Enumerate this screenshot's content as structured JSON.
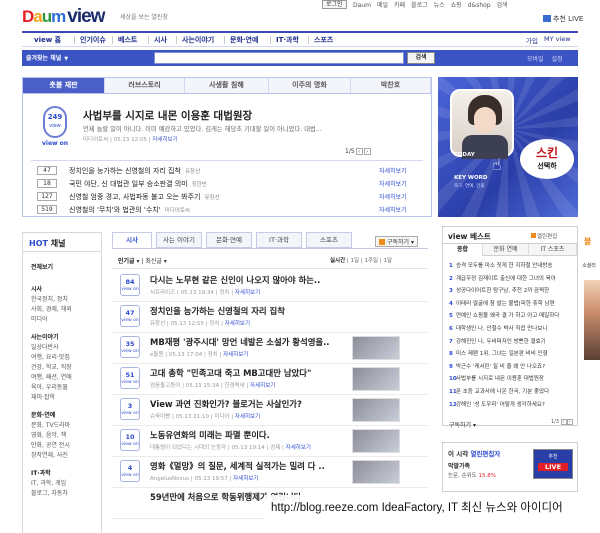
{
  "header": {
    "logo_brand": "Daum",
    "logo_product": "view",
    "tagline": "세상을 보는 열린창",
    "login_label": "로그인",
    "top_links": [
      "Daum",
      "메일",
      "카페",
      "블로그",
      "뉴스",
      "쇼핑",
      "d&shop",
      "검색"
    ],
    "recommend_label": "추천 LIVE"
  },
  "nav": {
    "items": [
      "view 홈",
      "인기이슈",
      "베스트",
      "시사",
      "사는이야기",
      "문화·연예",
      "IT·과학",
      "스포츠"
    ],
    "right_items": [
      "가입",
      "MY view"
    ]
  },
  "search": {
    "channel_label": "즐겨찾는 채널",
    "button_label": "검색",
    "right_links": [
      "모바일",
      "설정"
    ]
  },
  "featured": {
    "tabs": [
      "촛불 재판",
      "러브스토리",
      "사생활 침해",
      "이주의 명화",
      "박찬호"
    ],
    "badge_count": "249",
    "badge_unit": "view",
    "badge_label": "view on",
    "headline": "사법부를 시지로 내몬 이용훈 대법원장",
    "desc": "언제 놀랄 일이 아니다. 이미 예감하고 있었다. 김게는 해당초 기대할 일이 아니었다. 대법...",
    "meta_source": "미디어토씨",
    "meta_time": "05.13 12:05",
    "meta_more": "자세히보기",
    "pager": "1/5",
    "list": [
      {
        "count": "47",
        "title": "정치인을 능가하는 신영철의 자리 집착",
        "src": "유창선",
        "more": "자세히보기"
      },
      {
        "count": "18",
        "title": "국민 야단, 신 대법관 일부 승소판결 의미",
        "src": "정한빈",
        "more": "자세히보기"
      },
      {
        "count": "127",
        "title": "신영철 엄중 경고, 사법파동 불고 오는 봐주기",
        "src": "유창선",
        "more": "자세히보기"
      },
      {
        "count": "519",
        "title": "신영철의 '무치'와 법관의 '수치'",
        "src": "미디어토씨",
        "more": "자세히보기"
      }
    ]
  },
  "banner": {
    "today_label": "TODAY",
    "keyword_label": "KEY WORD",
    "sub_text": "죽구, 연예, 인물",
    "bubble_main": "스킨",
    "bubble_sub": "선택하"
  },
  "hot_channel": {
    "title_prefix": "HOT",
    "title_suffix": "채널",
    "all_label": "전체보기",
    "groups": [
      {
        "head": "시사",
        "lines": [
          "한국정치, 정치",
          "사회, 경제, 해외",
          "미디어"
        ]
      },
      {
        "head": "사는이야기",
        "lines": [
          "일상다반사",
          "여행, 요리·맛집",
          "건강, 학교, 직장",
          "여행, 패션, 연애",
          "육아, 우리동물",
          "재미·잡학"
        ]
      },
      {
        "head": "문화·연예",
        "lines": [
          "문화, TV드라마",
          "영화, 음악, 책",
          "만화, 공연 전시",
          "창작연재, 사진"
        ]
      },
      {
        "head": "IT·과학",
        "lines": [
          "IT, 과학, 게임",
          "블로그, 자동차"
        ]
      }
    ]
  },
  "center": {
    "tabs": [
      "시사",
      "사는 이야기",
      "문화·연예",
      "IT·과학",
      "스포츠"
    ],
    "subscribe_label": "구독하기",
    "sort_popular": "인기글",
    "sort_recent": "최신글",
    "live_label": "실시간",
    "live_periods": [
      "1일",
      "1주일",
      "1달"
    ],
    "articles": [
      {
        "count": "84",
        "unit": "view on",
        "title": "다시는 노무현 같은 신인이 나오지 않아야 하는..",
        "src": "서프라이즈",
        "time": "05.13 19:34",
        "cat": "정치",
        "more": "자세히보기",
        "thumb": false
      },
      {
        "count": "47",
        "unit": "view on",
        "title": "정치인을 능가하는 신영철의 자리 집착",
        "src": "유창선",
        "time": "05.13 12:55",
        "cat": "정치",
        "more": "자세히보기",
        "thumb": false
      },
      {
        "count": "35",
        "unit": "view on",
        "title": "MB재평 '광주시대' 망언 네발은 소설가 황석영을..",
        "src": "e돌쫑",
        "time": "05.13 17:04",
        "cat": "정치",
        "more": "자세히보기",
        "thumb": true
      },
      {
        "count": "51",
        "unit": "view on",
        "title": "고대 총학 \"민족고대 죽고 MB고대만 남았다\"",
        "src": "엄음돌고등어",
        "time": "05.13 15:34",
        "cat": "한겸퀵네",
        "more": "자세히보기",
        "thumb": true
      },
      {
        "count": "3",
        "unit": "view on",
        "title": "View 과연 진화인가? 블로거는 사살인가?",
        "src": "슈욱미빵",
        "time": "05.13 21:10",
        "cat": "미디어",
        "more": "자세히보기",
        "thumb": true
      },
      {
        "count": "10",
        "unit": "view on",
        "title": "노동유연화의 미래는 파멸 뿐이다.",
        "src": "대통령이 되었다는 시대의 눈동자",
        "time": "05.13 19:14",
        "cat": "경제",
        "more": "자세히보기",
        "thumb": true
      },
      {
        "count": "4",
        "unit": "view on",
        "title": "영화《멀망》의 질문, 세계적 실적가는 밀려 다 ..",
        "src": "AngelusNovus",
        "time": "05.13 19:57",
        "cat": "",
        "more": "자세히보기",
        "thumb": true
      },
      {
        "count": "",
        "unit": "",
        "title": "59년만에 처음으로 학동위행제가 열립니다",
        "src": "",
        "time": "",
        "cat": "",
        "more": "",
        "thumb": false
      }
    ]
  },
  "view_best": {
    "title": "view 베스트",
    "sub_label": "열린편집",
    "tabs": [
      "종합",
      "문화 연예",
      "IT 스포츠"
    ],
    "items": [
      "승격 모두를 미소 짓게 한 지하철 안내방송",
      "계급우정 김재이트 출신에 대한 그녀의 육아",
      "성공다이어트한 탐구남, 추천 2까 끔찍한",
      "이태리 얼굴에 참 발는 불법[피한 휴학 남편",
      "연예인 쇼핑몰 왜곡 결 가 하고 아고 매일하다",
      "대학생인 나, 안철수 박사 직접 만나보니",
      "강해진인 나, 두비퍼저인 방뻔한 결효기",
      "미스 제팬 1위, 그녀는 일본판 비비 인형",
      "박근수 '케서린' 질 비 줄 왜 안 나오죠?",
      "사법부를 시지로 내몬 이용훈 대법원장",
      "폰 초등 교과서에 나온 한국, 기분 좋았다",
      "강해인 '성 도우미' 어떻게 생각하세요?"
    ],
    "more_label": "구독하기",
    "pager": "1/3"
  },
  "editor": {
    "title_prefix": "이 시각",
    "title_main": "열린편집자",
    "name": "막말가족",
    "line_prefix": "눈문, 순위도 ",
    "line_rate": "15.8%",
    "img_top": "추천",
    "img_badge": "LIVE"
  },
  "edge_ad": {
    "text1": "볼",
    "text2": "소셜리"
  },
  "watermark": "http://blog.reeze.com IdeaFactory, IT 최신 뉴스와 아이디어"
}
